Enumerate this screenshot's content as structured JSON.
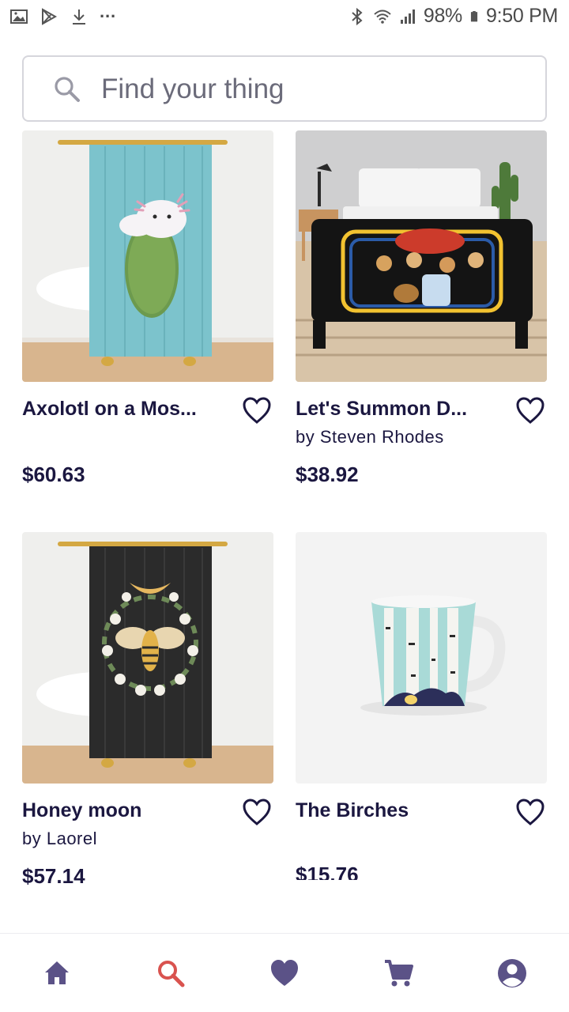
{
  "status_bar": {
    "battery": "98%",
    "time": "9:50 PM",
    "more": "···"
  },
  "search": {
    "placeholder": "Find your thing"
  },
  "products": [
    {
      "title": "Axolotl on a Mos...",
      "artist": "",
      "price": "$60.63"
    },
    {
      "title": "Let's Summon D...",
      "artist": "by Steven Rhodes",
      "price": "$38.92"
    },
    {
      "title": "Honey moon",
      "artist": "by Laorel",
      "price": "$57.14"
    },
    {
      "title": "The Birches",
      "artist": "",
      "price": "$15.76"
    }
  ],
  "nav": {
    "items": [
      "home-icon",
      "search-icon",
      "heart-icon",
      "cart-icon",
      "account-icon"
    ],
    "active": "search-icon"
  },
  "colors": {
    "text": "#1b1740",
    "nav_icon": "#5b5287",
    "nav_active": "#d9534f"
  }
}
